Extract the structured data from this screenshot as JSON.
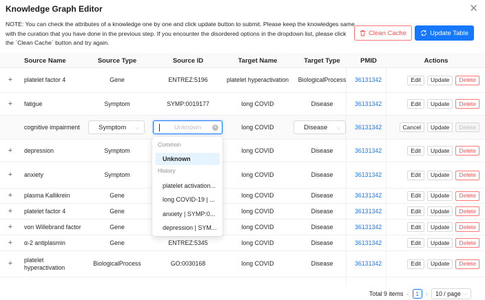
{
  "header": {
    "title": "Knowledge Graph Editor",
    "close_icon": "close-icon"
  },
  "note": {
    "lines": [
      "NOTE: You can check the attributes of a knowledge one by one and click update button to submit. Please keep the knowledges same",
      "with the curation that you have done in the previous step. If you encounter the disordered options in the dropdown list, please click",
      "the `Clean Cache` button and try again."
    ]
  },
  "toolbar": {
    "clean_cache_label": "Clean Cache",
    "clean_cache_icon": "trash-icon",
    "update_table_label": "Update Table",
    "update_table_icon": "sync-icon"
  },
  "colors": {
    "primary": "#1677ff",
    "danger": "#ff4d4f"
  },
  "table": {
    "columns": [
      "Source Name",
      "Source Type",
      "Source ID",
      "Target Name",
      "Target Type",
      "PMID",
      "Actions"
    ],
    "action_labels": {
      "edit": "Edit",
      "update": "Update",
      "delete": "Delete",
      "cancel": "Cancel"
    },
    "rows": [
      {
        "source_name": "platelet factor 4",
        "source_type": "Gene",
        "source_id": "ENTREZ:5196",
        "target_name": "platelet hyperactivation",
        "target_type": "BiologicalProcess",
        "pmid": "36131342"
      },
      {
        "source_name": "fatigue",
        "source_type": "Symptom",
        "source_id": "SYMP:0019177",
        "target_name": "long COVID",
        "target_type": "Disease",
        "pmid": "36131342"
      },
      {
        "source_name": "cognitive impairment",
        "source_type": "Symptom",
        "source_id": "Unknown",
        "target_name": "long COVID",
        "target_type": "Disease",
        "pmid": "36131342",
        "editing": true
      },
      {
        "source_name": "depression",
        "source_type": "Symptom",
        "source_id": "",
        "target_name": "long COVID",
        "target_type": "Disease",
        "pmid": "36131342"
      },
      {
        "source_name": "anxiety",
        "source_type": "Symptom",
        "source_id": "",
        "target_name": "long COVID",
        "target_type": "Disease",
        "pmid": "36131342"
      },
      {
        "source_name": "plasma Kallikrein",
        "source_type": "Gene",
        "source_id": "",
        "target_name": "long COVID",
        "target_type": "Disease",
        "pmid": "36131342"
      },
      {
        "source_name": "platelet factor 4",
        "source_type": "Gene",
        "source_id": "",
        "target_name": "long COVID",
        "target_type": "Disease",
        "pmid": "36131342"
      },
      {
        "source_name": "von Willebrand factor",
        "source_type": "Gene",
        "source_id": "",
        "target_name": "long COVID",
        "target_type": "Disease",
        "pmid": "36131342"
      },
      {
        "source_name": "α-2 antiplasmin",
        "source_type": "Gene",
        "source_id": "ENTREZ:5345",
        "target_name": "long COVID",
        "target_type": "Disease",
        "pmid": "36131342"
      },
      {
        "source_name": "platelet hyperactivation",
        "source_type": "BiologicalProcess",
        "source_id": "GO:0030168",
        "target_name": "long COVID",
        "target_type": "Disease",
        "pmid": "36131342"
      }
    ]
  },
  "dropdown": {
    "common_label": "Common",
    "common_items": [
      "Unknown"
    ],
    "history_label": "History",
    "history_items": [
      "platelet activation...",
      "long COVID-19 | ...",
      "anxiety | SYMP:0...",
      "depression | SYM..."
    ]
  },
  "pagination": {
    "total_text": "Total 9 items",
    "current_page": "1",
    "page_size": "10 / page"
  }
}
